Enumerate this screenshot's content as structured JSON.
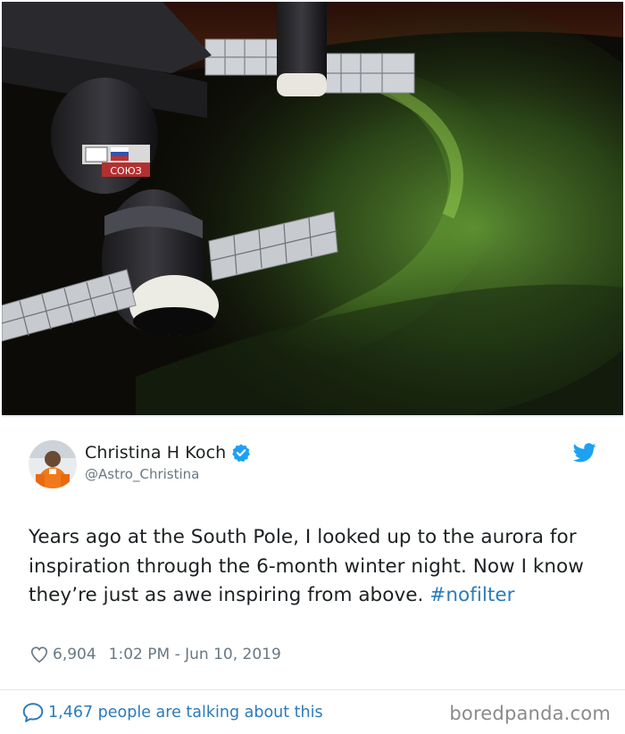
{
  "tweet": {
    "author_name": "Christina H Koch",
    "author_handle": "@Astro_Christina",
    "text_main": "Years ago at the South Pole, I looked up to the aurora for inspiration through the 6-month winter night. Now I know they’re just as awe inspiring from above. ",
    "hashtag": "#nofilter",
    "likes": "6,904",
    "timestamp": "1:02 PM - Jun 10, 2019",
    "talking": "1,467 people are talking about this",
    "capsule_label": "СОЮЗ"
  },
  "watermark": "boredpanda.com",
  "colors": {
    "link": "#2b7bb9",
    "muted": "#697882",
    "verified": "#1da1f2",
    "aurora": "#7fc63a"
  },
  "icons": [
    "verified-icon",
    "twitter-bird-icon",
    "heart-icon",
    "speech-bubble-icon"
  ]
}
